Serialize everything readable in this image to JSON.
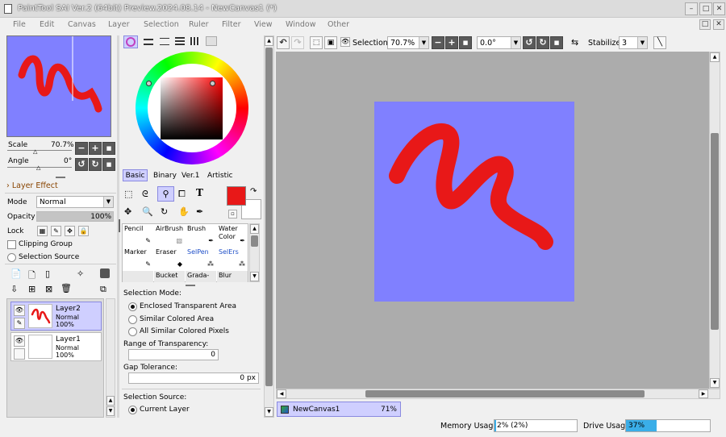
{
  "window": {
    "title": "PaintTool SAI Ver.2 (64bit) Preview.2024.08.14 - NewCanvas1 (*)"
  },
  "menu": [
    "File",
    "Edit",
    "Canvas",
    "Layer",
    "Selection",
    "Ruler",
    "Filter",
    "View",
    "Window",
    "Other"
  ],
  "navigator": {
    "scale_label": "Scale",
    "scale_value": "70.7%",
    "angle_label": "Angle",
    "angle_value": "0°"
  },
  "layer_effect": {
    "header": "Layer Effect",
    "mode_label": "Mode",
    "mode_value": "Normal",
    "opacity_label": "Opacity",
    "opacity_value": "100%",
    "opacity_fraction": 1.0,
    "lock_label": "Lock",
    "clipping_group": "Clipping Group",
    "selection_source": "Selection Source"
  },
  "layers": [
    {
      "name": "Layer2",
      "mode": "Normal",
      "opacity": "100%",
      "selected": true
    },
    {
      "name": "Layer1",
      "mode": "Normal",
      "opacity": "100%",
      "selected": false
    }
  ],
  "color": {
    "primary": "#e81818",
    "secondary": "#ffffff",
    "background_hex": "#8080ff"
  },
  "color_tabs": [
    "Basic",
    "Binary",
    "Ver.1",
    "Artistic"
  ],
  "brushes": [
    [
      "Pencil",
      "AirBrush",
      "Brush",
      "Water Color"
    ],
    [
      "Marker",
      "Eraser",
      "SelPen",
      "SelErs"
    ],
    [
      "",
      "Bucket",
      "Grada-",
      "Blur"
    ]
  ],
  "selection_tool": {
    "mode_label": "Selection Mode:",
    "options": [
      "Enclosed Transparent Area",
      "Similar Colored Area",
      "All Similar Colored Pixels"
    ],
    "selected_option": 0,
    "transparency_label": "Range of Transparency:",
    "transparency_value": "0",
    "gap_label": "Gap Tolerance:",
    "gap_value": "0 px",
    "source_label": "Selection Source:",
    "source_value": "Current Layer"
  },
  "toolbar": {
    "selection_label": "Selection",
    "zoom_value": "70.7%",
    "angle_value": "0.0°",
    "stabilizer_label": "Stabilizer",
    "stabilizer_value": "3"
  },
  "canvas_tab": {
    "name": "NewCanvas1",
    "zoom": "71%"
  },
  "status": {
    "memory_label": "Memory Usage",
    "memory_value": "2% (2%)",
    "memory_fraction": 0.02,
    "drive_label": "Drive Usage",
    "drive_value": "37%",
    "drive_fraction": 0.37
  }
}
